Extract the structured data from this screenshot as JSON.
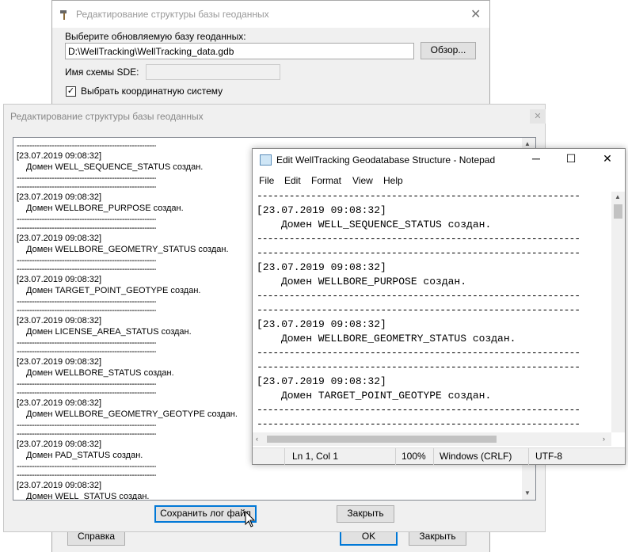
{
  "back_dialog": {
    "title": "Редактирование структуры базы геоданных",
    "select_db_label": "Выберите обновляемую базу геоданных:",
    "db_path": "D:\\WellTracking\\WellTracking_data.gdb",
    "browse_label": "Обзор...",
    "sde_label": "Имя схемы SDE:",
    "sde_value": "",
    "coord_checkbox_label": "Выбрать координатную систему",
    "help_label": "Справка",
    "ok_label": "OK",
    "close_label": "Закрыть"
  },
  "log_dialog": {
    "title": "Редактирование структуры базы геоданных",
    "separator": "------------------------------------------------------------",
    "entries": [
      {
        "timestamp": "[23.07.2019 09:08:32]",
        "message": "Домен WELL_SEQUENCE_STATUS создан."
      },
      {
        "timestamp": "[23.07.2019 09:08:32]",
        "message": "Домен WELLBORE_PURPOSE создан."
      },
      {
        "timestamp": "[23.07.2019 09:08:32]",
        "message": "Домен WELLBORE_GEOMETRY_STATUS создан."
      },
      {
        "timestamp": "[23.07.2019 09:08:32]",
        "message": "Домен TARGET_POINT_GEOTYPE создан."
      },
      {
        "timestamp": "[23.07.2019 09:08:32]",
        "message": "Домен LICENSE_AREA_STATUS создан."
      },
      {
        "timestamp": "[23.07.2019 09:08:32]",
        "message": "Домен WELLBORE_STATUS создан."
      },
      {
        "timestamp": "[23.07.2019 09:08:32]",
        "message": "Домен WELLBORE_GEOMETRY_GEOTYPE создан."
      },
      {
        "timestamp": "[23.07.2019 09:08:32]",
        "message": "Домен PAD_STATUS создан."
      },
      {
        "timestamp": "[23.07.2019 09:08:32]",
        "message": "Домен WELL_STATUS создан."
      }
    ],
    "save_log_label": "Сохранить лог файл",
    "close_label": "Закрыть"
  },
  "notepad": {
    "title": "Edit WellTracking Geodatabase Structure - Notepad",
    "menu": [
      "File",
      "Edit",
      "Format",
      "View",
      "Help"
    ],
    "separator": "------------------------------------------------------------",
    "entries": [
      {
        "timestamp": "[23.07.2019 09:08:32]",
        "message": "Домен WELL_SEQUENCE_STATUS создан."
      },
      {
        "timestamp": "[23.07.2019 09:08:32]",
        "message": "Домен WELLBORE_PURPOSE создан."
      },
      {
        "timestamp": "[23.07.2019 09:08:32]",
        "message": "Домен WELLBORE_GEOMETRY_STATUS создан."
      },
      {
        "timestamp": "[23.07.2019 09:08:32]",
        "message": "Домен TARGET_POINT_GEOTYPE создан."
      }
    ],
    "status": {
      "position": "Ln 1, Col 1",
      "zoom": "100%",
      "line_endings": "Windows (CRLF)",
      "encoding": "UTF-8"
    }
  }
}
